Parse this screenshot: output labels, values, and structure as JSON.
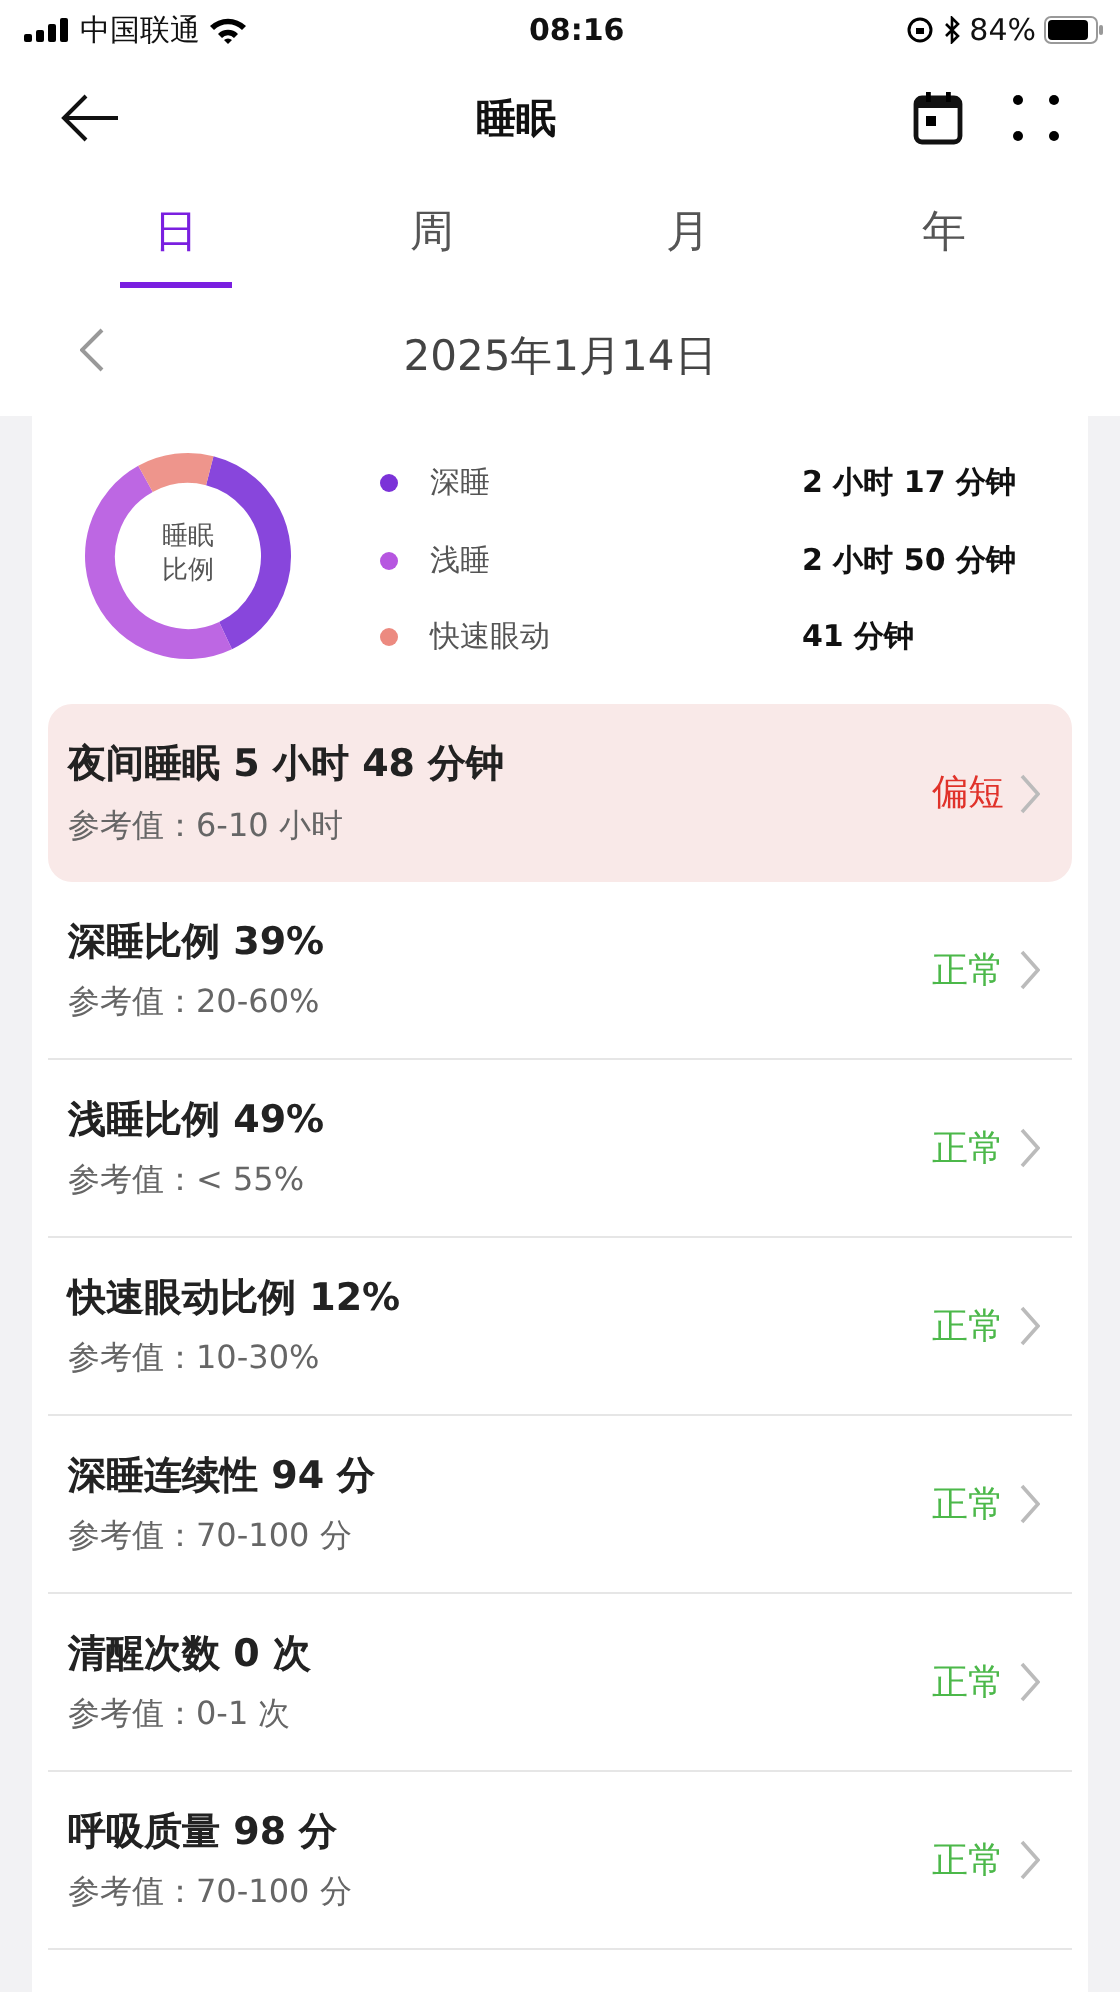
{
  "status_bar": {
    "carrier": "中国联通",
    "time": "08:16",
    "battery": "84%"
  },
  "header": {
    "title": "睡眠"
  },
  "tabs": [
    {
      "label": "日",
      "selected": true
    },
    {
      "label": "周",
      "selected": false
    },
    {
      "label": "月",
      "selected": false
    },
    {
      "label": "年",
      "selected": false
    }
  ],
  "date": "2025年1月14日",
  "donut": {
    "center_label": "睡眠比例"
  },
  "legend": [
    {
      "label": "深睡",
      "value": "2 小时 17 分钟",
      "color": "#7b32d8"
    },
    {
      "label": "浅睡",
      "value": "2 小时 50 分钟",
      "color": "#b656e0"
    },
    {
      "label": "快速眼动",
      "value": "41 分钟",
      "color": "#ec8a80"
    }
  ],
  "metrics": [
    {
      "title": "夜间睡眠 5 小时 48 分钟",
      "reference": "参考值：6-10 小时",
      "status": "偏短",
      "kind": "warning"
    },
    {
      "title": "深睡比例 39%",
      "reference": "参考值：20-60%",
      "status": "正常",
      "kind": "normal"
    },
    {
      "title": "浅睡比例 49%",
      "reference": "参考值：< 55%",
      "status": "正常",
      "kind": "normal"
    },
    {
      "title": "快速眼动比例 12%",
      "reference": "参考值：10-30%",
      "status": "正常",
      "kind": "normal"
    },
    {
      "title": "深睡连续性 94 分",
      "reference": "参考值：70-100 分",
      "status": "正常",
      "kind": "normal"
    },
    {
      "title": "清醒次数 0 次",
      "reference": "参考值：0-1 次",
      "status": "正常",
      "kind": "normal"
    },
    {
      "title": "呼吸质量 98 分",
      "reference": "参考值：70-100 分",
      "status": "正常",
      "kind": "normal"
    }
  ]
}
